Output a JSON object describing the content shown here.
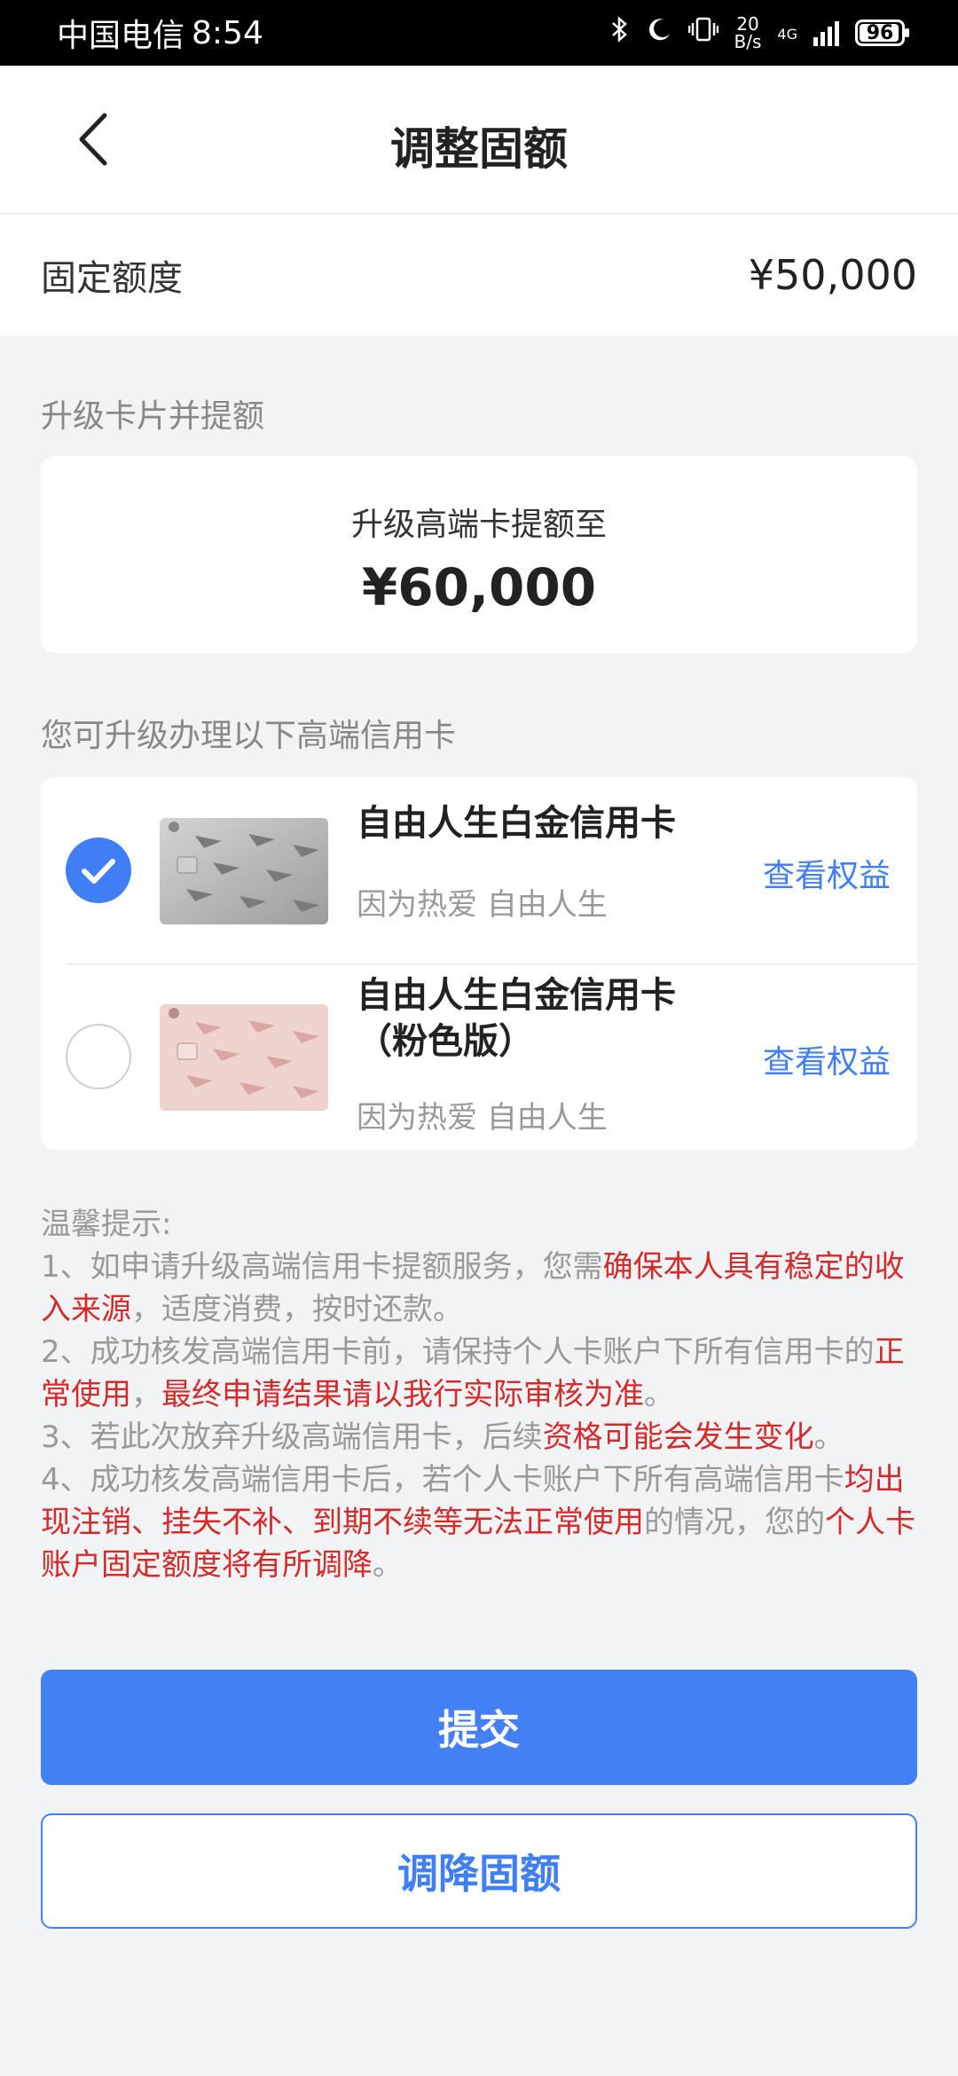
{
  "status_bar": {
    "carrier": "中国电信",
    "time": "8:54",
    "net_speed_top": "20",
    "net_speed_bottom": "B/s",
    "net_type": "4G",
    "battery": "96"
  },
  "nav": {
    "title": "调整固额"
  },
  "fixed_limit": {
    "label": "固定额度",
    "value": "¥50,000"
  },
  "upgrade": {
    "section_label": "升级卡片并提额",
    "subtitle": "升级高端卡提额至",
    "amount": "¥60,000"
  },
  "cards_section_label": "您可升级办理以下高端信用卡",
  "cards": [
    {
      "name": "自由人生白金信用卡",
      "tagline": "因为热爱 自由人生",
      "link": "查看权益",
      "selected": true,
      "card_color": "#b8b8b8"
    },
    {
      "name_line1": "自由人生白金信用卡",
      "name_line2": "（粉色版）",
      "tagline": "因为热爱 自由人生",
      "link": "查看权益",
      "selected": false,
      "card_color": "#e8c8c4"
    }
  ],
  "notes": {
    "title": "温馨提示:",
    "n1_a": "1、如申请升级高端信用卡提额服务，您需",
    "n1_red": "确保本人具有稳定的收入来源",
    "n1_b": "，适度消费，按时还款。",
    "n2_a": "2、成功核发高端信用卡前，请保持个人卡账户下所有信用卡的",
    "n2_red1": "正常使用",
    "n2_b": "，",
    "n2_red2": "最终申请结果请以我行实际审核为准",
    "n2_c": "。",
    "n3_a": "3、若此次放弃升级高端信用卡，后续",
    "n3_red": "资格可能会发生变化",
    "n3_b": "。",
    "n4_a": "4、成功核发高端信用卡后，若个人卡账户下所有高端信用卡",
    "n4_red1": "均出现注销、挂失不补、到期不续等无法正常使用",
    "n4_b": "的情况，您的",
    "n4_red2": "个人卡账户固定额度将有所调降",
    "n4_c": "。"
  },
  "buttons": {
    "submit": "提交",
    "reduce": "调降固额"
  },
  "colors": {
    "accent": "#4280f4",
    "warning": "#d42a2a"
  }
}
